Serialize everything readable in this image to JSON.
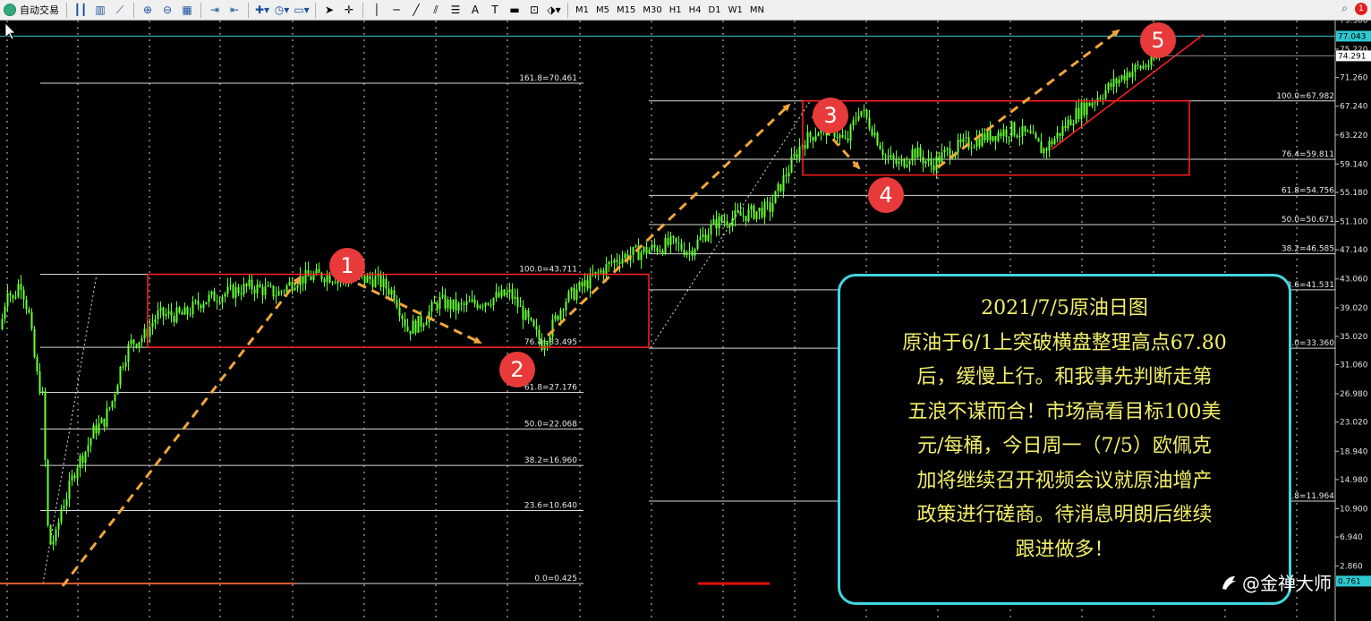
{
  "toolbar": {
    "auto_trade_label": "自动交易",
    "timeframes": [
      "M1",
      "M5",
      "M15",
      "M30",
      "H1",
      "H4",
      "D1",
      "W1",
      "MN"
    ],
    "notification_count": "1"
  },
  "price_axis": {
    "ticks": [
      "79.300",
      "75.220",
      "71.260",
      "67.240",
      "63.220",
      "59.140",
      "55.180",
      "51.100",
      "47.140",
      "43.060",
      "39.020",
      "35.020",
      "31.060",
      "26.980",
      "23.020",
      "18.940",
      "14.980",
      "10.900",
      "6.940",
      "2.860"
    ],
    "current_price": "74.291",
    "line_price": "77.043",
    "bottom_price": "0.761"
  },
  "fib_left": [
    {
      "label": "161.8=70.461",
      "value": 70.461
    },
    {
      "label": "100.0=43.711",
      "value": 43.711
    },
    {
      "label": "76.4=33.495",
      "value": 33.495
    },
    {
      "label": "61.8=27.176",
      "value": 27.176
    },
    {
      "label": "50.0=22.068",
      "value": 22.068
    },
    {
      "label": "38.2=16.960",
      "value": 16.96
    },
    {
      "label": "23.6=10.640",
      "value": 10.64
    },
    {
      "label": "0.0=0.425",
      "value": 0.425
    }
  ],
  "fib_right": [
    {
      "label": "100.0=67.982",
      "value": 67.982
    },
    {
      "label": "76.4=59.811",
      "value": 59.811
    },
    {
      "label": "61.8=54.756",
      "value": 54.756
    },
    {
      "label": "50.0=50.671",
      "value": 50.671
    },
    {
      "label": "38.2=46.585",
      "value": 46.585
    },
    {
      "label": "3.6=41.531",
      "value": 41.531
    },
    {
      "label": "0.0=33.360",
      "value": 33.36
    },
    {
      "label": "1.8=11.964",
      "value": 11.964
    }
  ],
  "wave_labels": [
    "1",
    "2",
    "3",
    "4",
    "5"
  ],
  "colors": {
    "candle": "#66ff33",
    "fib": "#d8d8d8",
    "box": "#ff2020",
    "arrow": "#f2a63a",
    "badge": "#e83a3a",
    "annot_border": "#3fd6e0",
    "annot_text": "#f3ef6a",
    "cyan_line": "#2ec8d0"
  },
  "annotation": {
    "lines": [
      "2021/7/5原油日图",
      "原油于6/1上突破横盘整理高点67.80",
      "后，缓慢上行。和我事先判断走第",
      "五浪不谋而合！市场高看目标100美",
      "元/每桶，今日周一（7/5）欧佩克",
      "加将继续召开视频会议就原油增产",
      "政策进行磋商。待消息明朗后继续",
      "跟进做多！"
    ]
  },
  "watermark": {
    "text": "@金禅大师"
  }
}
